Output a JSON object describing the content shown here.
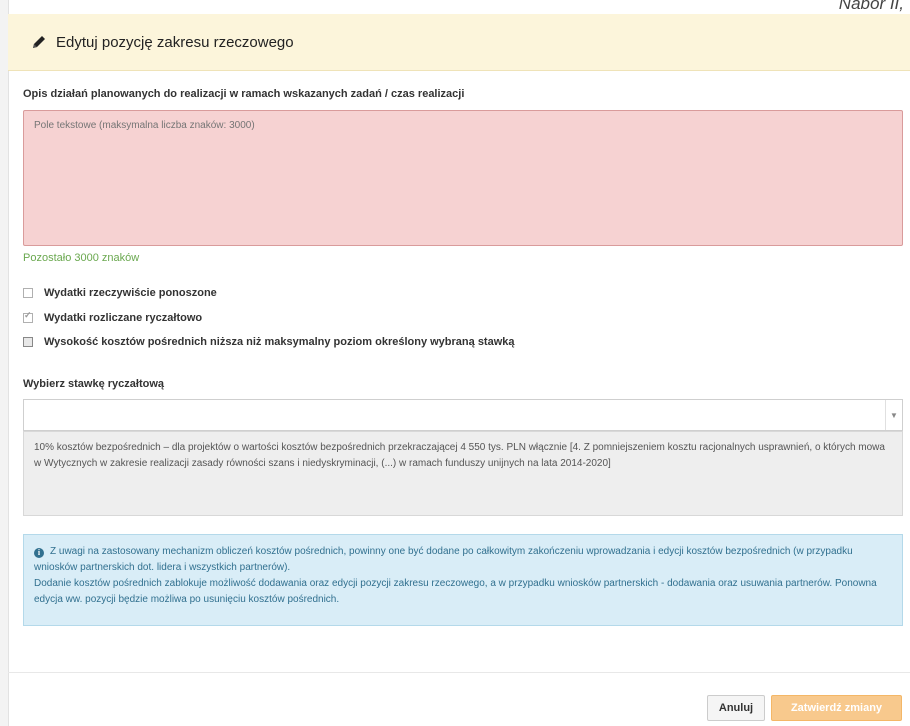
{
  "corner_text": "Nabór II,",
  "header": {
    "icon": "pencil-icon",
    "title": "Edytuj pozycję zakresu rzeczowego"
  },
  "description_field": {
    "label": "Opis działań planowanych do realizacji w ramach wskazanych zadań / czas realizacji",
    "placeholder": "Pole tekstowe (maksymalna liczba znaków: 3000)",
    "counter_text": "Pozostało 3000 znaków"
  },
  "checkboxes": [
    {
      "label": "Wydatki rzeczywiście ponoszone",
      "checked": false
    },
    {
      "label": "Wydatki rozliczane ryczałtowo",
      "checked": true
    },
    {
      "label": "Wysokość kosztów pośrednich niższa niż maksymalny poziom określony wybraną stawką",
      "checked": false
    }
  ],
  "rate_select": {
    "label": "Wybierz stawkę ryczałtową",
    "value": "",
    "description": "10% kosztów bezpośrednich – dla projektów o wartości kosztów bezpośrednich przekraczającej 4 550 tys. PLN włącznie [4. Z pomniejszeniem kosztu racjonalnych usprawnień, o których mowa w Wytycznych w zakresie realizacji zasady równości szans i niedyskryminacji, (...) w ramach funduszy unijnych na lata 2014-2020]"
  },
  "info": {
    "icon": "info-circle-icon",
    "line1": "Z uwagi na zastosowany mechanizm obliczeń kosztów pośrednich, powinny one być dodane po całkowitym zakończeniu wprowadzania i edycji kosztów bezpośrednich (w przypadku wniosków partnerskich dot. lidera i wszystkich partnerów).",
    "line2": "Dodanie kosztów pośrednich zablokuje możliwość dodawania oraz edycji pozycji zakresu rzeczowego, a w przypadku wniosków partnerskich - dodawania oraz usuwania partnerów. Ponowna edycja ww. pozycji będzie możliwa po usunięciu kosztów pośrednich."
  },
  "buttons": {
    "cancel": "Anuluj",
    "confirm": "Zatwierdź zmiany"
  },
  "colors": {
    "header_bg": "#fcf5db",
    "textarea_error_bg": "#f6d2d2",
    "counter_text": "#6aa84f",
    "info_bg": "#d9edf7",
    "confirm_button": "#f8c98d"
  }
}
